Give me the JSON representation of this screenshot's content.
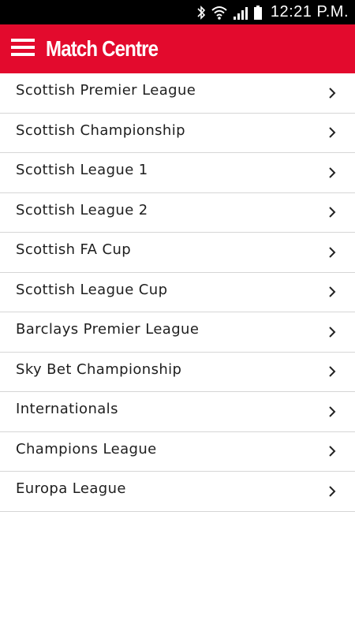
{
  "status_bar": {
    "time": "12:21 P.M.",
    "icons": [
      "bluetooth-icon",
      "wifi-icon",
      "signal-icon",
      "battery-icon"
    ]
  },
  "app_bar": {
    "menu_icon": "hamburger-menu-icon",
    "title": "Match Centre",
    "color": "#e30a2d"
  },
  "leagues": [
    {
      "label": "Scottish Premier League"
    },
    {
      "label": "Scottish Championship"
    },
    {
      "label": "Scottish League 1"
    },
    {
      "label": "Scottish League 2"
    },
    {
      "label": "Scottish FA Cup"
    },
    {
      "label": "Scottish League Cup"
    },
    {
      "label": "Barclays Premier League"
    },
    {
      "label": "Sky Bet Championship"
    },
    {
      "label": "Internationals"
    },
    {
      "label": "Champions League"
    },
    {
      "label": "Europa League"
    }
  ]
}
